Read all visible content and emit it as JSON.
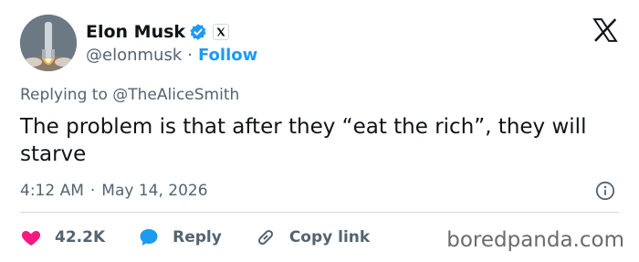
{
  "author": {
    "name": "Elon Musk",
    "handle": "@elonmusk",
    "follow_label": "Follow",
    "separator": "·"
  },
  "tweet": {
    "replying_to": "Replying to @TheAliceSmith",
    "text": "The problem is that after they “eat the rich”, they will starve",
    "time": "4:12 AM",
    "separator": "·",
    "date": "May 14, 2026"
  },
  "actions": {
    "likes_count": "42.2K",
    "reply_label": "Reply",
    "copy_link_label": "Copy link"
  },
  "watermark": "boredpanda.com",
  "colors": {
    "accent": "#1d9bf0",
    "like": "#f91880",
    "secondary_text": "#536471",
    "primary_text": "#0f1419"
  }
}
